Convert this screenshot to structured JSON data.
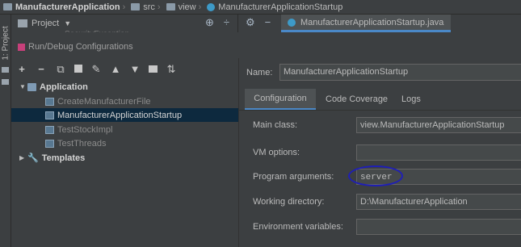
{
  "breadcrumb": {
    "project": "ManufacturerApplication",
    "folder1": "src",
    "folder2": "view",
    "file": "ManufacturerApplicationStartup"
  },
  "toolstrip": {
    "project_label": "1: Project"
  },
  "project_panel": {
    "title": "Project",
    "ghost_item": "SecurityException",
    "icons": [
      "target-icon",
      "collapse-icon",
      "gear-icon",
      "minimize-icon"
    ]
  },
  "editor": {
    "tab_label": "ManufacturerApplicationStartup.java"
  },
  "dialog": {
    "title": "Run/Debug Configurations",
    "toolbar": [
      "+",
      "−",
      "⧉",
      "💾",
      "🔧",
      "▲",
      "▼",
      "📁",
      "↕"
    ],
    "tree": {
      "application_label": "Application",
      "items": [
        "CreateManufacturerFile",
        "ManufacturerApplicationStartup",
        "TestStockImpl",
        "TestThreads"
      ],
      "templates_label": "Templates"
    },
    "name_label": "Name:",
    "name_value": "ManufacturerApplicationStartup",
    "tabs": [
      "Configuration",
      "Code Coverage",
      "Logs"
    ],
    "fields": {
      "main_class_label": "Main class:",
      "main_class_value": "view.ManufacturerApplicationStartup",
      "vm_options_label": "VM options:",
      "vm_options_value": "",
      "program_args_label": "Program arguments:",
      "program_args_value": "server",
      "working_dir_label": "Working directory:",
      "working_dir_value": "D:\\ManufacturerApplication",
      "env_vars_label": "Environment variables:",
      "env_vars_value": ""
    }
  }
}
